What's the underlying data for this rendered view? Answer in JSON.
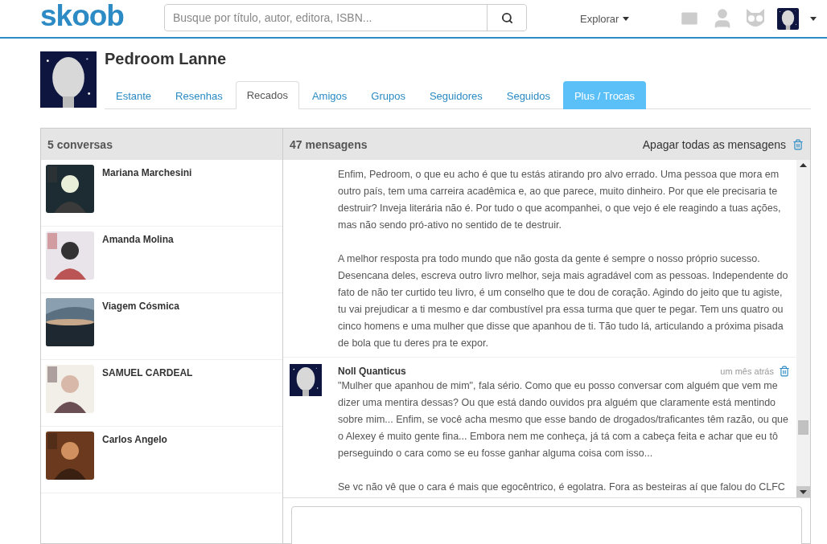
{
  "header": {
    "logo": "skoob",
    "search": {
      "placeholder": "Busque por título, autor, editora, ISBN..."
    },
    "explore": "Explorar"
  },
  "profile": {
    "name": "Pedroom Lanne"
  },
  "tabs": [
    {
      "label": "Estante",
      "selected": false,
      "kind": "normal"
    },
    {
      "label": "Resenhas",
      "selected": false,
      "kind": "normal"
    },
    {
      "label": "Recados",
      "selected": true,
      "kind": "normal"
    },
    {
      "label": "Amigos",
      "selected": false,
      "kind": "normal"
    },
    {
      "label": "Grupos",
      "selected": false,
      "kind": "normal"
    },
    {
      "label": "Seguidores",
      "selected": false,
      "kind": "normal"
    },
    {
      "label": "Seguidos",
      "selected": false,
      "kind": "normal"
    },
    {
      "label": "Plus / Trocas",
      "selected": false,
      "kind": "highlight"
    }
  ],
  "conversations": {
    "title": "5 conversas",
    "items": [
      {
        "name": "Mariana Marchesini"
      },
      {
        "name": "Amanda Molina"
      },
      {
        "name": "Viagem Cósmica"
      },
      {
        "name": "SAMUEL CARDEAL"
      },
      {
        "name": "Carlos Angelo"
      }
    ]
  },
  "messages": {
    "title": "47 mensagens",
    "delete_all": "Apagar todas as mensagens",
    "items": [
      {
        "paragraphs": [
          "Enfim, Pedroom, o que eu acho é que tu estás atirando pro alvo errado. Uma pessoa que mora em outro país, tem uma carreira acadêmica e, ao que parece, muito dinheiro. Por que ele precisaria te destruir? Inveja literária não é. Por tudo o que acompanhei, o que vejo é ele reagindo a tuas ações, mas não sendo pró-ativo no sentido de te destruir.",
          "A melhor resposta pra todo mundo que não gosta da gente é sempre o nosso próprio sucesso. Desencana deles, escreva outro livro melhor, seja mais agradável com as pessoas. Independente do fato de não ter curtido teu livro, é um conselho que te dou de coração. Agindo do jeito que tu agiste, tu vai prejudicar a ti mesmo e dar combustível pra essa turma que quer te pegar. Tem uns quatro ou cinco homens e uma mulher que disse que apanhou de ti. Tão tudo lá, articulando a próxima pisada de bola que tu deres pra te expor."
        ]
      },
      {
        "author": "Noll Quanticus",
        "time": "um mês atrás",
        "paragraphs": [
          "\"Mulher que apanhou de mim\", fala sério. Como que eu posso conversar com alguém que vem me dizer uma mentira dessas? Ou que está dando ouvidos pra alguém que claramente está mentindo sobre mim... Enfim, se você acha mesmo que esse bando de drogados/traficantes têm razão, ou que o Alexey é muito gente fina... Embora nem me conheça, já tá com a cabeça feita e achar que eu tô perseguindo o cara como se eu fosse ganhar alguma coisa com isso...",
          "Se vc não vê que o cara é mais que egocêntrico, é egolatra. Fora as besteiras aí que falou do CLFC"
        ]
      }
    ]
  }
}
